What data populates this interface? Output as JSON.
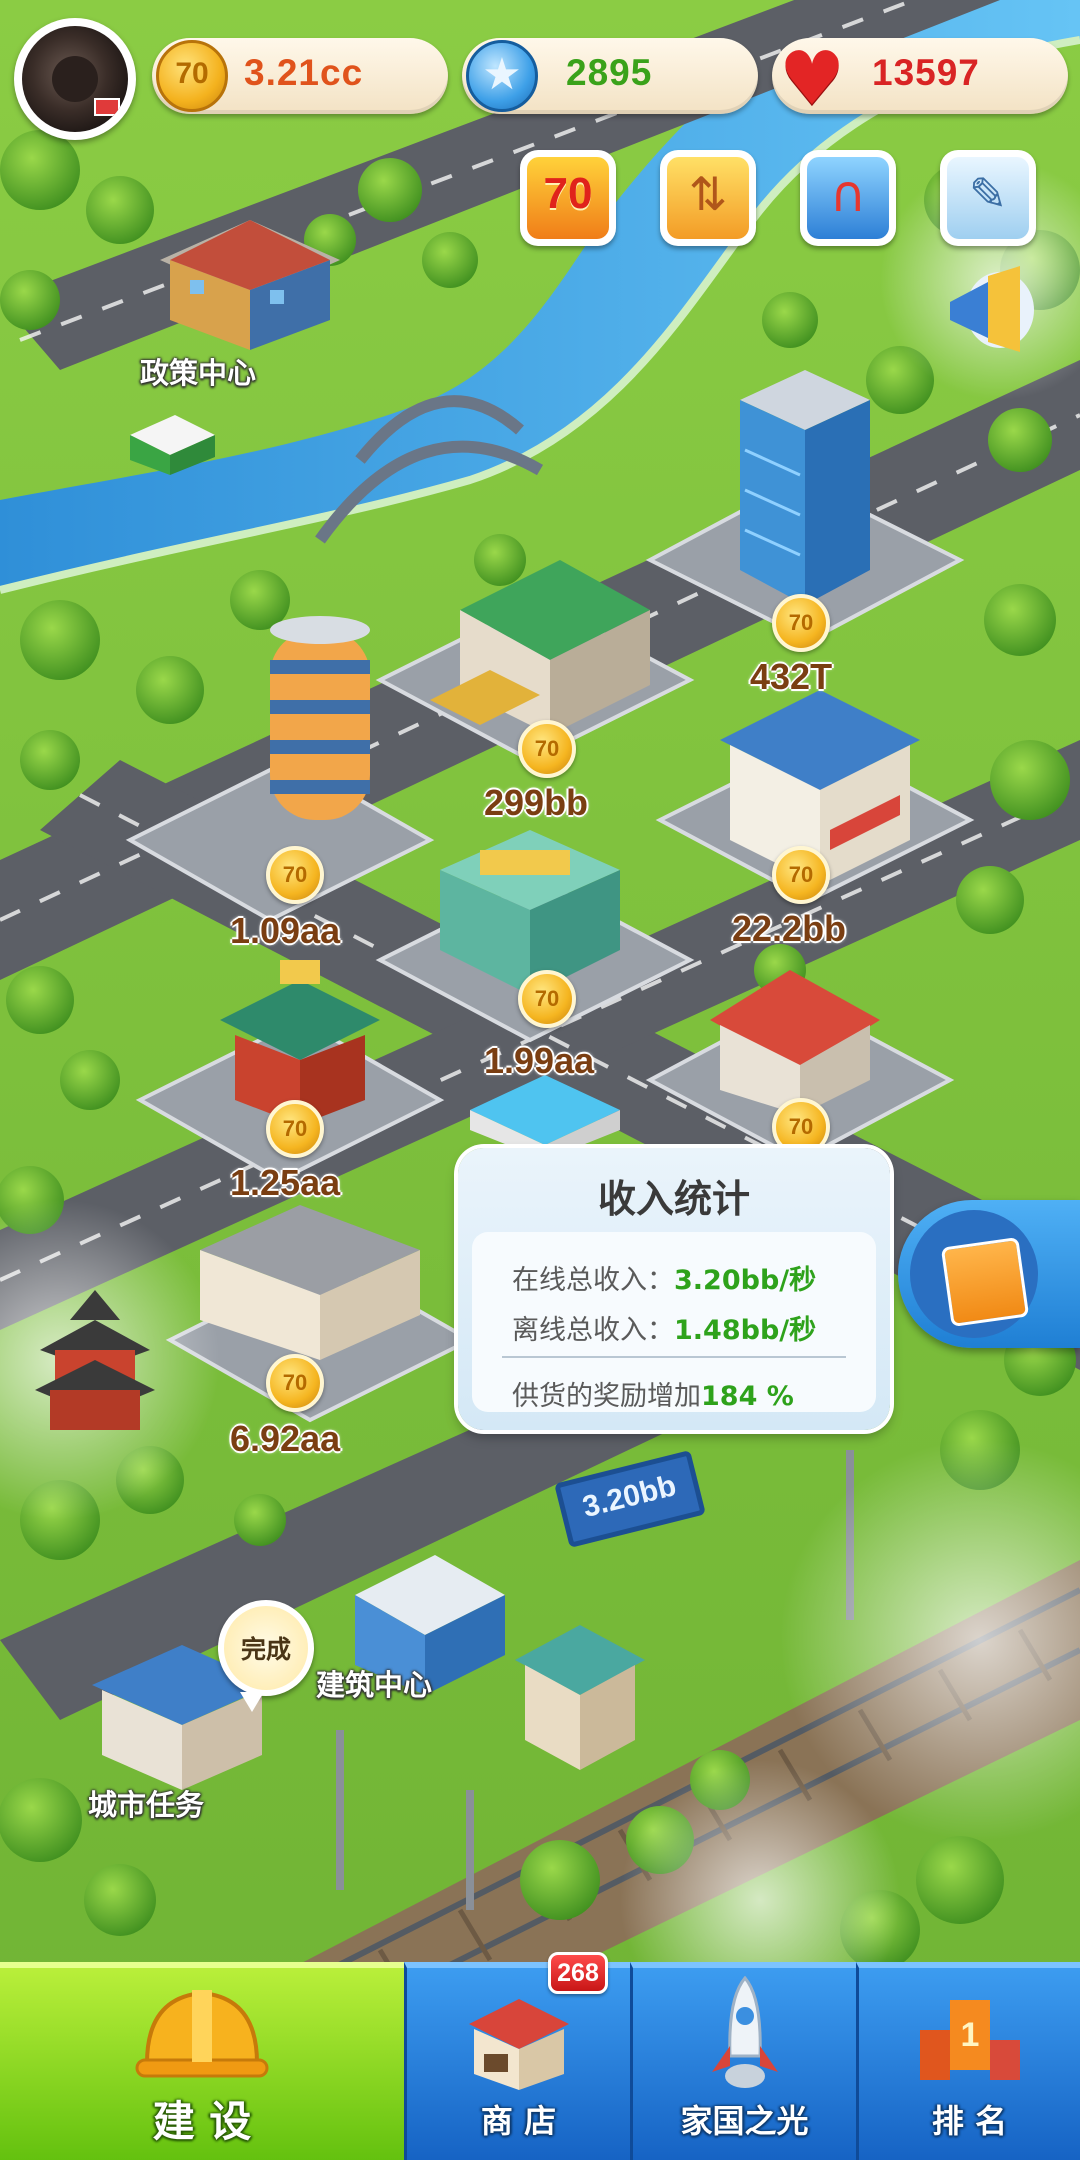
{
  "header": {
    "coins": "3.21cc",
    "stars": "2895",
    "hearts": "13597",
    "coin_symbol": "70"
  },
  "events": {
    "anniversary_label": "70"
  },
  "places": {
    "policy_center": "政策中心",
    "build_center": "建筑中心",
    "city_tasks": "城市任务"
  },
  "buildings": [
    {
      "name": "petro-tower",
      "income": "432T"
    },
    {
      "name": "warehouse",
      "income": "299bb"
    },
    {
      "name": "market",
      "income": "22.2bb"
    },
    {
      "name": "round-tower",
      "income": "1.09aa"
    },
    {
      "name": "mall",
      "income": "1.99aa"
    },
    {
      "name": "pavilion",
      "income": "1.25aa"
    },
    {
      "name": "garage",
      "income": "6.92aa"
    }
  ],
  "popup": {
    "title": "收入统计",
    "online_label": "在线总收入：",
    "online_value": "3.20bb/秒",
    "offline_label": "离线总收入：",
    "offline_value": "1.48bb/秒",
    "bonus_label": "供货的奖励增加",
    "bonus_value": "184 %"
  },
  "billboard": "3.20bb",
  "task_bubble": "完成",
  "nav": {
    "build": "建 设",
    "shop": "商 店",
    "shop_badge": "268",
    "glory": "家国之光",
    "rank": "排 名"
  },
  "colors": {
    "grass": "#7fc241",
    "river": "#3c9fe6",
    "road": "#5c5f66",
    "income_green": "#2ea21b",
    "nav_green": "#64c10f",
    "nav_blue": "#1663c4"
  }
}
